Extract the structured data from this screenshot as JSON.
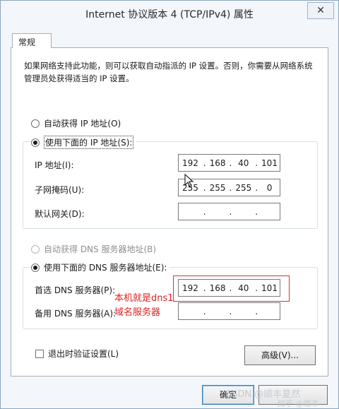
{
  "window": {
    "title": "Internet 协议版本 4 (TCP/IPv4) 属性",
    "close_icon": "close-icon"
  },
  "tab": {
    "label": "常规"
  },
  "description": "如果网络支持此功能，则可以获取自动指派的 IP 设置。否则，你需要从网络系统管理员处获得适当的 IP 设置。",
  "ip_section": {
    "auto_label": "自动获得 IP 地址(O)",
    "manual_label": "使用下面的 IP 地址(S):",
    "selected": "manual",
    "ip_label": "IP 地址(I):",
    "ip_value": [
      "192",
      "168",
      "40",
      "101"
    ],
    "subnet_label": "子网掩码(U):",
    "subnet_value": [
      "255",
      "255",
      "255",
      "0"
    ],
    "gateway_label": "默认网关(D):",
    "gateway_value": [
      "",
      "",
      "",
      ""
    ]
  },
  "dns_section": {
    "auto_label": "自动获得 DNS 服务器地址(B)",
    "manual_label": "使用下面的 DNS 服务器地址(E):",
    "selected": "manual",
    "preferred_label": "首选 DNS 服务器(P):",
    "preferred_value": [
      "192",
      "168",
      "40",
      "101"
    ],
    "alternate_label": "备用 DNS 服务器(A):",
    "alternate_value": [
      "",
      "",
      "",
      ""
    ]
  },
  "validate_checkbox": {
    "label": "退出时验证设置(L)",
    "checked": false
  },
  "advanced_button": "高级(V)...",
  "ok_button": "确定",
  "annotation": {
    "line1": "本机就是dns1",
    "line2": "域名服务器",
    "color": "#e02020"
  },
  "watermark": {
    "line1": "CSDN @顺丰夏然",
    "line2": "知乎 @顺丰"
  }
}
